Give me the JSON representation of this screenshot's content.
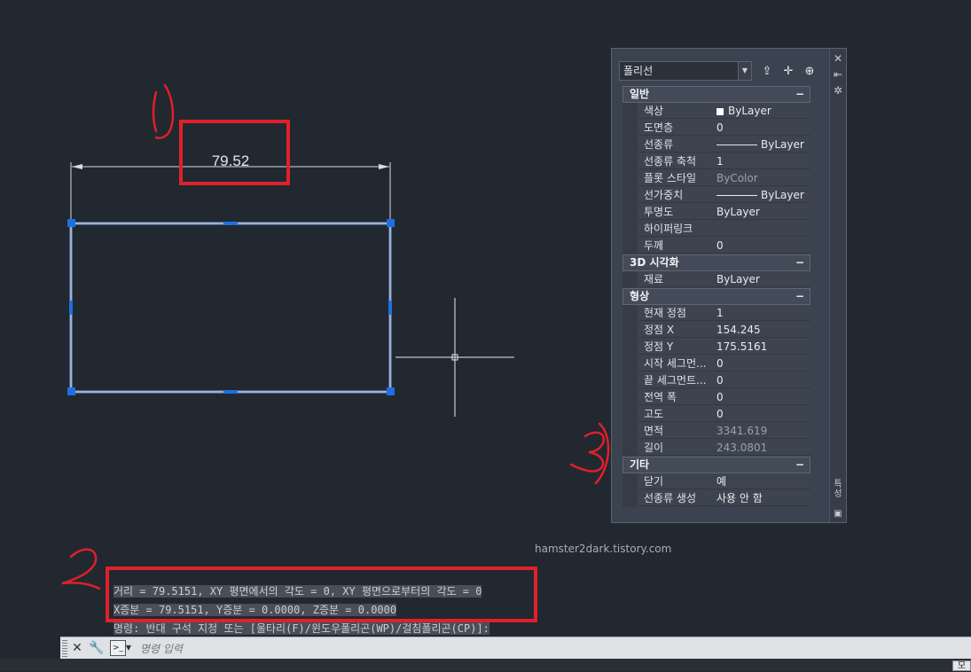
{
  "drawing": {
    "dimension_text": "79.52",
    "annotation_1": "1)",
    "annotation_2": "2)",
    "annotation_3": "3)"
  },
  "palette": {
    "object_type": "폴리선",
    "icons": [
      "quick-select-icon",
      "select-objects-icon",
      "toggle-pickadd-icon"
    ],
    "side_icons": [
      "close-icon",
      "auto-hide-icon",
      "properties-settings-icon"
    ],
    "side_label": "특성",
    "sections": [
      {
        "title": "일반",
        "rows": [
          {
            "name": "색상",
            "value": "ByLayer",
            "swatch": "#ffffff"
          },
          {
            "name": "도면층",
            "value": "0"
          },
          {
            "name": "선종류",
            "value": "ByLayer",
            "line": true
          },
          {
            "name": "선종류 축척",
            "value": "1"
          },
          {
            "name": "플롯 스타일",
            "value": "ByColor",
            "dim": true
          },
          {
            "name": "선가중치",
            "value": "ByLayer",
            "line": true
          },
          {
            "name": "투명도",
            "value": "ByLayer"
          },
          {
            "name": "하이퍼링크",
            "value": ""
          },
          {
            "name": "두께",
            "value": "0"
          }
        ]
      },
      {
        "title": "3D 시각화",
        "rows": [
          {
            "name": "재료",
            "value": "ByLayer"
          }
        ]
      },
      {
        "title": "형상",
        "rows": [
          {
            "name": "현재 정점",
            "value": "1"
          },
          {
            "name": "정점 X",
            "value": "154.245"
          },
          {
            "name": "정점 Y",
            "value": "175.5161"
          },
          {
            "name": "시작 세그먼...",
            "value": "0"
          },
          {
            "name": "끝 세그먼트...",
            "value": "0"
          },
          {
            "name": "전역 폭",
            "value": "0"
          },
          {
            "name": "고도",
            "value": "0"
          },
          {
            "name": "면적",
            "value": "3341.619",
            "dim": true
          },
          {
            "name": "길이",
            "value": "243.0801",
            "dim": true
          }
        ]
      },
      {
        "title": "기타",
        "rows": [
          {
            "name": "닫기",
            "value": "예"
          },
          {
            "name": "선종류 생성",
            "value": "사용 안 함"
          }
        ]
      }
    ],
    "collapse_symbol": "−"
  },
  "watermark": "hamster2dark.tistory.com",
  "command_history": [
    "거리 = 79.5151,  XY 평면에서의 각도 = 0,  XY 평면으로부터의 각도 = 0",
    "X증분 = 79.5151,  Y증분 = 0.0000,   Z증분 = 0.0000",
    "명령: 반대 구석 지정 또는 [울타리(F)/윈도우폴리곤(WP)/걸침폴리곤(CP)]:"
  ],
  "command_bar": {
    "placeholder": "명령 입력",
    "close_icon": "close-icon",
    "customize_icon": "wrench-icon",
    "prompt_icon": "command-prompt-icon"
  },
  "model_tab": "모"
}
